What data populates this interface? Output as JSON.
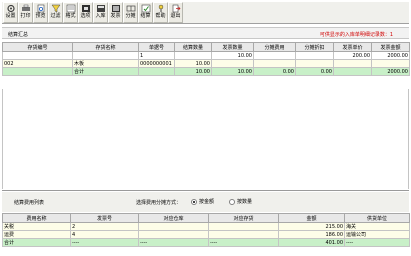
{
  "toolbar": {
    "buttons": [
      {
        "label": "设置",
        "icon": "settings-icon"
      },
      {
        "label": "打印",
        "icon": "printer-icon"
      },
      {
        "label": "预览",
        "icon": "preview-icon"
      },
      {
        "label": "过滤",
        "icon": "filter-icon"
      },
      {
        "label": "格式",
        "icon": "format-icon"
      },
      {
        "label": "选项",
        "icon": "options-icon"
      },
      {
        "label": "入库",
        "icon": "warehouse-in-icon"
      },
      {
        "label": "发票",
        "icon": "invoice-icon"
      },
      {
        "label": "分摊",
        "icon": "allocate-icon"
      },
      {
        "label": "结算",
        "icon": "settle-icon"
      },
      {
        "label": "帮助",
        "icon": "help-icon"
      },
      {
        "label": "退出",
        "icon": "exit-icon"
      }
    ]
  },
  "summary": {
    "title": "结算汇总",
    "info": "可供显示的入库单明细记录数：1",
    "headers": [
      "存货编号",
      "存货名称",
      "单据号",
      "结算数量",
      "发票数量",
      "分摊费用",
      "分摊折扣",
      "发票单价",
      "发票金额"
    ],
    "rows": [
      {
        "code": "",
        "name": "",
        "doc_no": "1",
        "settle_qty": "",
        "invoice_qty": "10.00",
        "alloc_fee": "",
        "alloc_disc": "",
        "unit_price": "200.00",
        "amount": "2000.00"
      },
      {
        "code": "002",
        "name": "木板",
        "doc_no": "0000000001",
        "settle_qty": "10.00",
        "invoice_qty": "",
        "alloc_fee": "",
        "alloc_disc": "",
        "unit_price": "",
        "amount": ""
      },
      {
        "code": "",
        "name": "合计",
        "doc_no": "",
        "settle_qty": "10.00",
        "invoice_qty": "10.00",
        "alloc_fee": "0.00",
        "alloc_disc": "0.00",
        "unit_price": "",
        "amount": "2000.00"
      }
    ]
  },
  "fees": {
    "title": "结算费用列表",
    "method_label": "选择费用分摊方式：",
    "option_amount": "按金额",
    "option_qty": "按数量",
    "selected": "按金额",
    "headers": [
      "费用名称",
      "发票号",
      "对应仓库",
      "对应存货",
      "金额",
      "供货单位"
    ],
    "rows": [
      {
        "name": "关税",
        "invoice_no": "2",
        "warehouse": "",
        "item": "",
        "amount": "215.00",
        "supplier": "海关"
      },
      {
        "name": "运费",
        "invoice_no": "4",
        "warehouse": "",
        "item": "",
        "amount": "186.00",
        "supplier": "运输公司"
      },
      {
        "name": "合计",
        "invoice_no": "----",
        "warehouse": "----",
        "item": "----",
        "amount": "401.00",
        "supplier": "----"
      }
    ]
  }
}
